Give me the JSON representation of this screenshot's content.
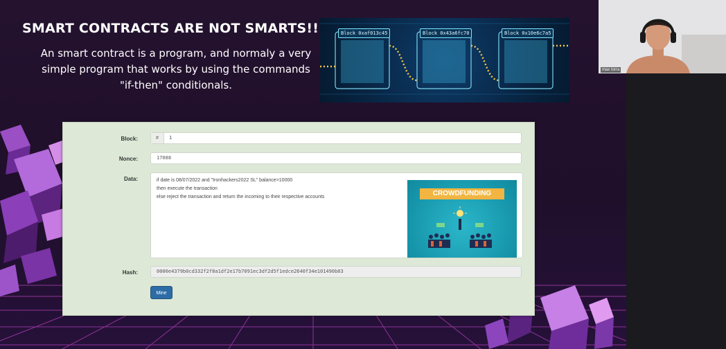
{
  "slide": {
    "title": "SMART CONTRACTS ARE NOT SMARTS!!",
    "body_lines": [
      "An smart contract is a program, and normaly a very",
      "simple program that works by using the commands",
      "\"if-then\" conditionals."
    ],
    "chain_blocks": [
      "Block 0xaf013c45",
      "Block 0x43a6fc70",
      "Block 0x10e6c7a5"
    ]
  },
  "blockchain_demo": {
    "block_label": "Block:",
    "block_addon": "#",
    "block_value": "1",
    "nonce_label": "Nonce:",
    "nonce_value": "17088",
    "data_label": "Data:",
    "data_lines": [
      "if date is 08/07/2022 and \"Ironhackers2022 SL\" balance>10000",
      "then execute the transaction",
      "else reject the transaction and return the incoming to their respective accounts"
    ],
    "data_image_caption": "CROWDFUNDING",
    "hash_label": "Hash:",
    "hash_value": "0000e4379b0cd332f2f8a1df2e17b7091ec3df2d5f1edce2640f34e101490b03",
    "mine_label": "Mine"
  },
  "webcam": {
    "participant_name": "max torra"
  },
  "colors": {
    "slide_background": "#24122f",
    "panel_background": "#dde8d6",
    "mine_button": "#2d6ca6",
    "crowdfunding_banner": "#f2b541",
    "crowdfunding_bg": "#1797ac"
  }
}
